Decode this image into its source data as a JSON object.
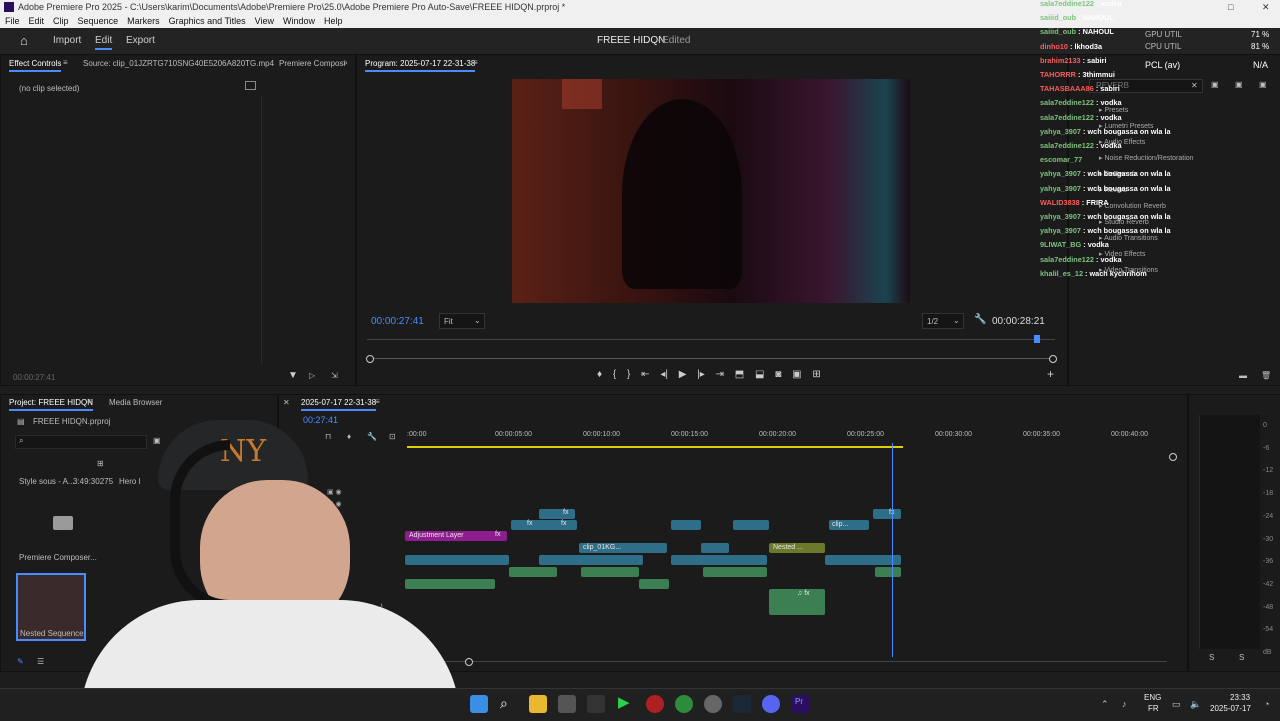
{
  "titlebar": {
    "text": "Adobe Premiere Pro 2025 - C:\\Users\\karim\\Documents\\Adobe\\Premiere Pro\\25.0\\Adobe Premiere Pro Auto-Save\\FREEE HIDQN.prproj *"
  },
  "menu": [
    "File",
    "Edit",
    "Clip",
    "Sequence",
    "Markers",
    "Graphics and Titles",
    "View",
    "Window",
    "Help"
  ],
  "appbar": {
    "tabs": [
      "Import",
      "Edit",
      "Export"
    ],
    "project_title": "FREEE HIDQN",
    "status": "- Edited"
  },
  "effect_controls": {
    "tab": "Effect Controls",
    "source": "Source: clip_01JZRTG710SNG40E5206A820TG.mp4",
    "composer": "Premiere Composi",
    "empty": "(no clip selected)",
    "timecode": "00:00:27:41"
  },
  "program": {
    "tab": "Program: 2025-07-17 22-31-38",
    "timecode": "00:00:27:41",
    "fit": "Fit",
    "quality": "1/2",
    "duration": "00:00:28:21"
  },
  "project": {
    "tab": "Project: FREEE HIDQN",
    "media_browser": "Media Browser",
    "file": "FREEE HIDQN.prproj",
    "items": [
      {
        "name": "Style sous - A...",
        "duration": "3:49:30275"
      },
      {
        "name": "Premiere Composer..."
      },
      {
        "name": "Nested Sequence"
      }
    ],
    "hero": "Hero l"
  },
  "timeline": {
    "tab": "2025-07-17 22-31-38",
    "timecode": "00:27:41",
    "ruler": [
      ":00:00",
      "00:00:05:00",
      "00:00:10:00",
      "00:00:15:00",
      "00:00:20:00",
      "00:00:25:00",
      "00:00:30:00",
      "00:00:35:00",
      "00:00:40:00"
    ],
    "clips": {
      "adjustment": "Adjustment Layer",
      "clip1": "clip_01KG...",
      "nested": "Nested ...",
      "clip2": "clip..."
    }
  },
  "meter": {
    "labels": [
      "0",
      "-6",
      "-12",
      "-18",
      "-24",
      "-30",
      "-36",
      "-42",
      "-48",
      "-54",
      "dB"
    ],
    "bottom": [
      "S",
      "S"
    ]
  },
  "effects_panel": {
    "gpu": "GPU UTIL",
    "cpu": "CPU UTIL",
    "gpu_val": "71 %",
    "cpu_val": "81 %",
    "pcl": "PCL (av)",
    "na": "N/A",
    "search": "REVERB",
    "tree": [
      "Presets",
      "Lumetri Presets",
      "Audio Effects",
      "Noise Reduction/Restoration",
      "DeReverb",
      "Reverb",
      "Convolution Reverb",
      "Studio Reverb",
      "Audio Transitions",
      "Video Effects",
      "Video Transitions"
    ]
  },
  "chat": [
    {
      "user": "sala7eddine122",
      "msg": "vodka",
      "c": "n"
    },
    {
      "user": "saiiid_oub",
      "msg": "NAHOUL",
      "c": "n"
    },
    {
      "user": "saiiid_oub",
      "msg": "NAHOUL",
      "c": "n"
    },
    {
      "user": "dinho10",
      "msg": "lkhod3a",
      "c": "r"
    },
    {
      "user": "brahim2133",
      "msg": "sabiri",
      "c": "r"
    },
    {
      "user": "TAHORRR",
      "msg": "3thimmui",
      "c": "r"
    },
    {
      "user": "TAHASBAAA86",
      "msg": "sabiri",
      "c": "r"
    },
    {
      "user": "sala7eddine122",
      "msg": "vodka",
      "c": "n"
    },
    {
      "user": "sala7eddine122",
      "msg": "vodka",
      "c": "n"
    },
    {
      "user": "yahya_3907",
      "msg": "wch bougassa on wla la",
      "c": "n"
    },
    {
      "user": "sala7eddine122",
      "msg": "vodka",
      "c": "n"
    },
    {
      "user": "escomar_77",
      "msg": "",
      "c": "n"
    },
    {
      "user": "yahya_3907",
      "msg": "wch bougassa on wla la",
      "c": "n"
    },
    {
      "user": "yahya_3907",
      "msg": "wch bougassa on wla la",
      "c": "n"
    },
    {
      "user": "WALID3838",
      "msg": "FRIRA",
      "c": "r"
    },
    {
      "user": "yahya_3907",
      "msg": "wch bougassa on wla la",
      "c": "n"
    },
    {
      "user": "yahya_3907",
      "msg": "wch bougassa on wla la",
      "c": "n"
    },
    {
      "user": "9LIWAT_BG",
      "msg": "vodka",
      "c": "n"
    },
    {
      "user": "sala7eddine122",
      "msg": "vodka",
      "c": "n"
    },
    {
      "user": "khalil_es_12",
      "msg": "wach kychrihom",
      "c": "n"
    }
  ],
  "taskbar": {
    "lang": "ENG",
    "region": "FR",
    "time": "23:33",
    "date": "2025-07-17"
  },
  "colors": {
    "accent": "#4a8cff",
    "video_clip": "#2f6e88",
    "audio_clip": "#3b7f52",
    "adjustment": "#8e1e8e",
    "playhead": "#4a8cff"
  }
}
